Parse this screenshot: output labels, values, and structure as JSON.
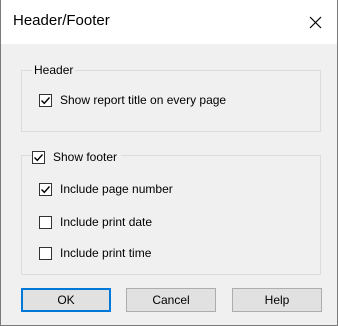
{
  "dialog": {
    "title": "Header/Footer",
    "close_icon": "close-icon"
  },
  "header_group": {
    "caption": "Header",
    "show_title": {
      "label": "Show report title on every page",
      "checked": true
    }
  },
  "footer_group": {
    "show_footer": {
      "label": "Show footer",
      "checked": true
    },
    "options": [
      {
        "label": "Include page number",
        "checked": true
      },
      {
        "label": "Include print date",
        "checked": false
      },
      {
        "label": "Include print time",
        "checked": false
      }
    ]
  },
  "buttons": {
    "ok": "OK",
    "cancel": "Cancel",
    "help": "Help"
  },
  "colors": {
    "accent": "#0078d7",
    "dialog_bg": "#f0f0f0",
    "titlebar_bg": "#ffffff"
  }
}
